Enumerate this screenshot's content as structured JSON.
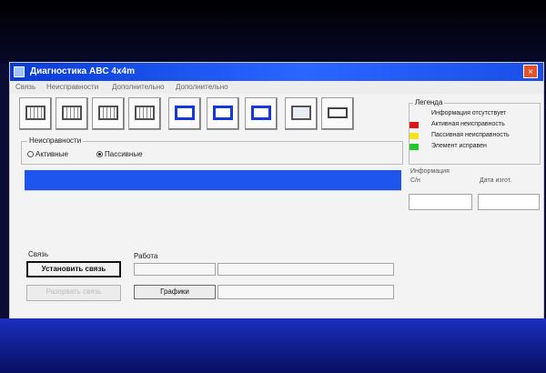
{
  "window": {
    "title": "Диагностика ABC 4x4m",
    "close_glyph": "×"
  },
  "menubar": {
    "items": [
      "Связь",
      "Неисправности",
      "Дополнительно",
      "Дополнительно"
    ]
  },
  "toolbar": {
    "buttons": [
      {
        "icon": "waveform-icon"
      },
      {
        "icon": "waveform-icon"
      },
      {
        "icon": "waveform-icon"
      },
      {
        "icon": "waveform-icon"
      },
      {
        "icon": "blue-frame-icon"
      },
      {
        "icon": "blue-frame-icon"
      },
      {
        "icon": "blue-frame-icon"
      },
      {
        "icon": "monitor-icon"
      },
      {
        "icon": "battery-icon"
      }
    ]
  },
  "faults": {
    "group_label": "Неисправности",
    "active_label": "Активные",
    "passive_label": "Пассивные",
    "selected": "passive"
  },
  "legend": {
    "title": "Легенда",
    "items": [
      {
        "color": "#f3f3f3",
        "label": "Информация отсутствует"
      },
      {
        "color": "#e01717",
        "label": "Активная неисправность"
      },
      {
        "color": "#f3e51a",
        "label": "Пассивная неисправность"
      },
      {
        "color": "#22c82c",
        "label": "Элемент исправен"
      }
    ]
  },
  "info": {
    "title": "Информация",
    "left_label": "С/н",
    "right_label": "Дата изгот."
  },
  "connection": {
    "group_label": "Связь",
    "connect_button": "Установить связь",
    "disconnect_button": "Разорвать связь"
  },
  "work": {
    "label": "Работа",
    "graphs_button": "Графики"
  },
  "colors": {
    "titlebar": "#1b4ee8",
    "band": "#1d55ee"
  }
}
